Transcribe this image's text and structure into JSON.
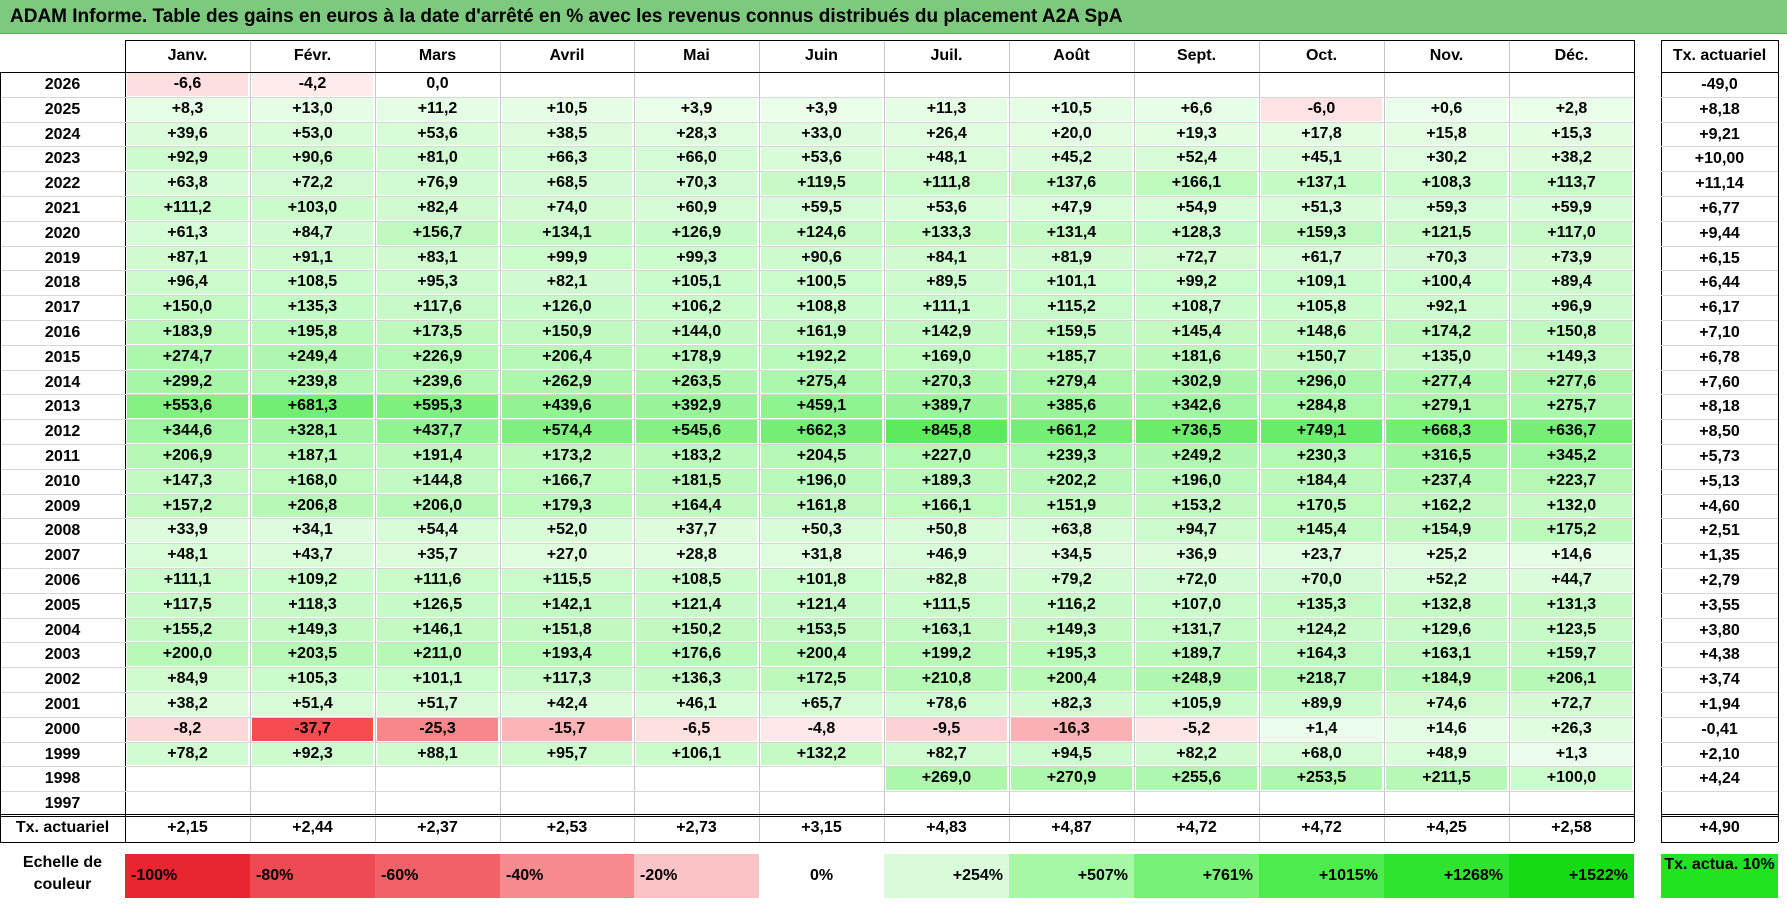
{
  "title": "ADAM Informe. Table des gains en euros à la date d'arrêté en % avec les revenus connus distribués du placement A2A SpA",
  "months": [
    "Janv.",
    "Févr.",
    "Mars",
    "Avril",
    "Mai",
    "Juin",
    "Juil.",
    "Août",
    "Sept.",
    "Oct.",
    "Nov.",
    "Déc."
  ],
  "tx_header": "Tx. actuariel",
  "rows": [
    {
      "year": "2026",
      "values": [
        "-6,6",
        "-4,2",
        "0,0",
        "",
        "",
        "",
        "",
        "",
        "",
        "",
        "",
        ""
      ],
      "tx": "-49,0"
    },
    {
      "year": "2025",
      "values": [
        "+8,3",
        "+13,0",
        "+11,2",
        "+10,5",
        "+3,9",
        "+3,9",
        "+11,3",
        "+10,5",
        "+6,6",
        "-6,0",
        "+0,6",
        "+2,8"
      ],
      "tx": "+8,18"
    },
    {
      "year": "2024",
      "values": [
        "+39,6",
        "+53,0",
        "+53,6",
        "+38,5",
        "+28,3",
        "+33,0",
        "+26,4",
        "+20,0",
        "+19,3",
        "+17,8",
        "+15,8",
        "+15,3"
      ],
      "tx": "+9,21"
    },
    {
      "year": "2023",
      "values": [
        "+92,9",
        "+90,6",
        "+81,0",
        "+66,3",
        "+66,0",
        "+53,6",
        "+48,1",
        "+45,2",
        "+52,4",
        "+45,1",
        "+30,2",
        "+38,2"
      ],
      "tx": "+10,00"
    },
    {
      "year": "2022",
      "values": [
        "+63,8",
        "+72,2",
        "+76,9",
        "+68,5",
        "+70,3",
        "+119,5",
        "+111,8",
        "+137,6",
        "+166,1",
        "+137,1",
        "+108,3",
        "+113,7"
      ],
      "tx": "+11,14"
    },
    {
      "year": "2021",
      "values": [
        "+111,2",
        "+103,0",
        "+82,4",
        "+74,0",
        "+60,9",
        "+59,5",
        "+53,6",
        "+47,9",
        "+54,9",
        "+51,3",
        "+59,3",
        "+59,9"
      ],
      "tx": "+6,77"
    },
    {
      "year": "2020",
      "values": [
        "+61,3",
        "+84,7",
        "+156,7",
        "+134,1",
        "+126,9",
        "+124,6",
        "+133,3",
        "+131,4",
        "+128,3",
        "+159,3",
        "+121,5",
        "+117,0"
      ],
      "tx": "+9,44"
    },
    {
      "year": "2019",
      "values": [
        "+87,1",
        "+91,1",
        "+83,1",
        "+99,9",
        "+99,3",
        "+90,6",
        "+84,1",
        "+81,9",
        "+72,7",
        "+61,7",
        "+70,3",
        "+73,9"
      ],
      "tx": "+6,15"
    },
    {
      "year": "2018",
      "values": [
        "+96,4",
        "+108,5",
        "+95,3",
        "+82,1",
        "+105,1",
        "+100,5",
        "+89,5",
        "+101,1",
        "+99,2",
        "+109,1",
        "+100,4",
        "+89,4"
      ],
      "tx": "+6,44"
    },
    {
      "year": "2017",
      "values": [
        "+150,0",
        "+135,3",
        "+117,6",
        "+126,0",
        "+106,2",
        "+108,8",
        "+111,1",
        "+115,2",
        "+108,7",
        "+105,8",
        "+92,1",
        "+96,9"
      ],
      "tx": "+6,17"
    },
    {
      "year": "2016",
      "values": [
        "+183,9",
        "+195,8",
        "+173,5",
        "+150,9",
        "+144,0",
        "+161,9",
        "+142,9",
        "+159,5",
        "+145,4",
        "+148,6",
        "+174,2",
        "+150,8"
      ],
      "tx": "+7,10"
    },
    {
      "year": "2015",
      "values": [
        "+274,7",
        "+249,4",
        "+226,9",
        "+206,4",
        "+178,9",
        "+192,2",
        "+169,0",
        "+185,7",
        "+181,6",
        "+150,7",
        "+135,0",
        "+149,3"
      ],
      "tx": "+6,78"
    },
    {
      "year": "2014",
      "values": [
        "+299,2",
        "+239,8",
        "+239,6",
        "+262,9",
        "+263,5",
        "+275,4",
        "+270,3",
        "+279,4",
        "+302,9",
        "+296,0",
        "+277,4",
        "+277,6"
      ],
      "tx": "+7,60"
    },
    {
      "year": "2013",
      "values": [
        "+553,6",
        "+681,3",
        "+595,3",
        "+439,6",
        "+392,9",
        "+459,1",
        "+389,7",
        "+385,6",
        "+342,6",
        "+284,8",
        "+279,1",
        "+275,7"
      ],
      "tx": "+8,18"
    },
    {
      "year": "2012",
      "values": [
        "+344,6",
        "+328,1",
        "+437,7",
        "+574,4",
        "+545,6",
        "+662,3",
        "+845,8",
        "+661,2",
        "+736,5",
        "+749,1",
        "+668,3",
        "+636,7"
      ],
      "tx": "+8,50"
    },
    {
      "year": "2011",
      "values": [
        "+206,9",
        "+187,1",
        "+191,4",
        "+173,2",
        "+183,2",
        "+204,5",
        "+227,0",
        "+239,3",
        "+249,2",
        "+230,3",
        "+316,5",
        "+345,2"
      ],
      "tx": "+5,73"
    },
    {
      "year": "2010",
      "values": [
        "+147,3",
        "+168,0",
        "+144,8",
        "+166,7",
        "+181,5",
        "+196,0",
        "+189,3",
        "+202,2",
        "+196,0",
        "+184,4",
        "+237,4",
        "+223,7"
      ],
      "tx": "+5,13"
    },
    {
      "year": "2009",
      "values": [
        "+157,2",
        "+206,8",
        "+206,0",
        "+179,3",
        "+164,4",
        "+161,8",
        "+166,1",
        "+151,9",
        "+153,2",
        "+170,5",
        "+162,2",
        "+132,0"
      ],
      "tx": "+4,60"
    },
    {
      "year": "2008",
      "values": [
        "+33,9",
        "+34,1",
        "+54,4",
        "+52,0",
        "+37,7",
        "+50,3",
        "+50,8",
        "+63,8",
        "+94,7",
        "+145,4",
        "+154,9",
        "+175,2"
      ],
      "tx": "+2,51"
    },
    {
      "year": "2007",
      "values": [
        "+48,1",
        "+43,7",
        "+35,7",
        "+27,0",
        "+28,8",
        "+31,8",
        "+46,9",
        "+34,5",
        "+36,9",
        "+23,7",
        "+25,2",
        "+14,6"
      ],
      "tx": "+1,35"
    },
    {
      "year": "2006",
      "values": [
        "+111,1",
        "+109,2",
        "+111,6",
        "+115,5",
        "+108,5",
        "+101,8",
        "+82,8",
        "+79,2",
        "+72,0",
        "+70,0",
        "+52,2",
        "+44,7"
      ],
      "tx": "+2,79"
    },
    {
      "year": "2005",
      "values": [
        "+117,5",
        "+118,3",
        "+126,5",
        "+142,1",
        "+121,4",
        "+121,4",
        "+111,5",
        "+116,2",
        "+107,0",
        "+135,3",
        "+132,8",
        "+131,3"
      ],
      "tx": "+3,55"
    },
    {
      "year": "2004",
      "values": [
        "+155,2",
        "+149,3",
        "+146,1",
        "+151,8",
        "+150,2",
        "+153,5",
        "+163,1",
        "+149,3",
        "+131,7",
        "+124,2",
        "+129,6",
        "+123,5"
      ],
      "tx": "+3,80"
    },
    {
      "year": "2003",
      "values": [
        "+200,0",
        "+203,5",
        "+211,0",
        "+193,4",
        "+176,6",
        "+200,4",
        "+199,2",
        "+195,3",
        "+189,7",
        "+164,3",
        "+163,1",
        "+159,7"
      ],
      "tx": "+4,38"
    },
    {
      "year": "2002",
      "values": [
        "+84,9",
        "+105,3",
        "+101,1",
        "+117,3",
        "+136,3",
        "+172,5",
        "+210,8",
        "+200,4",
        "+248,9",
        "+218,7",
        "+184,9",
        "+206,1"
      ],
      "tx": "+3,74"
    },
    {
      "year": "2001",
      "values": [
        "+38,2",
        "+51,4",
        "+51,7",
        "+42,4",
        "+46,1",
        "+65,7",
        "+78,6",
        "+82,3",
        "+105,9",
        "+89,9",
        "+74,6",
        "+72,7"
      ],
      "tx": "+1,94"
    },
    {
      "year": "2000",
      "values": [
        "-8,2",
        "-37,7",
        "-25,3",
        "-15,7",
        "-6,5",
        "-4,8",
        "-9,5",
        "-16,3",
        "-5,2",
        "+1,4",
        "+14,6",
        "+26,3"
      ],
      "tx": "-0,41"
    },
    {
      "year": "1999",
      "values": [
        "+78,2",
        "+92,3",
        "+88,1",
        "+95,7",
        "+106,1",
        "+132,2",
        "+82,7",
        "+94,5",
        "+82,2",
        "+68,0",
        "+48,9",
        "+1,3"
      ],
      "tx": "+2,10"
    },
    {
      "year": "1998",
      "values": [
        "",
        "",
        "",
        "",
        "",
        "",
        "+269,0",
        "+270,9",
        "+255,6",
        "+253,5",
        "+211,5",
        "+100,0"
      ],
      "tx": "+4,24"
    },
    {
      "year": "1997",
      "values": [
        "",
        "",
        "",
        "",
        "",
        "",
        "",
        "",
        "",
        "",
        "",
        ""
      ],
      "tx": ""
    }
  ],
  "footer": {
    "label": "Tx. actuariel",
    "values": [
      "+2,15",
      "+2,44",
      "+2,37",
      "+2,53",
      "+2,73",
      "+3,15",
      "+4,83",
      "+4,87",
      "+4,72",
      "+4,72",
      "+4,25",
      "+2,58"
    ],
    "tx": "+4,90"
  },
  "scale": {
    "label": "Echelle de couleur",
    "items": [
      {
        "label": "-100%",
        "color": "#e9262f",
        "kind": "neg"
      },
      {
        "label": "-80%",
        "color": "#ee4a51",
        "kind": "neg"
      },
      {
        "label": "-60%",
        "color": "#f26168",
        "kind": "neg"
      },
      {
        "label": "-40%",
        "color": "#f58a8f",
        "kind": "neg"
      },
      {
        "label": "-20%",
        "color": "#fac3c6",
        "kind": "neg"
      },
      {
        "label": "0%",
        "color": "#ffffff",
        "kind": "zero"
      },
      {
        "label": "+254%",
        "color": "#d9fbd9",
        "kind": "pos"
      },
      {
        "label": "+507%",
        "color": "#a6f7a6",
        "kind": "pos"
      },
      {
        "label": "+761%",
        "color": "#77f277",
        "kind": "pos"
      },
      {
        "label": "+1015%",
        "color": "#4deb4d",
        "kind": "pos"
      },
      {
        "label": "+1268%",
        "color": "#2fe32f",
        "kind": "pos"
      },
      {
        "label": "+1522%",
        "color": "#15db15",
        "kind": "pos"
      }
    ],
    "tx_label": "Tx. actua. 10%",
    "tx_color": "#21e321"
  },
  "colors": {
    "title_bg": "#7dc97d",
    "neg_max": "#e9262f",
    "pos_max": "#15db15",
    "zero": "#ffffff"
  }
}
